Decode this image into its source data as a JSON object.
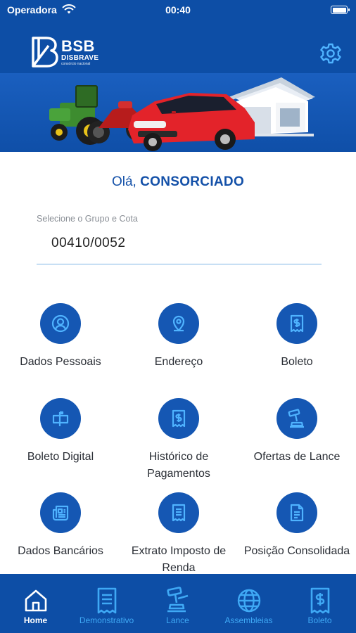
{
  "status_bar": {
    "carrier": "Operadora",
    "time": "00:40",
    "battery_level": 1.0
  },
  "header": {
    "logo_text": "BSB",
    "logo_subtext": "DISBRAVE",
    "logo_tagline": "consórcio nacional",
    "settings_icon": "gear-icon"
  },
  "greeting": {
    "prefix": "Olá,",
    "name": "CONSORCIADO"
  },
  "group_select": {
    "label": "Selecione o Grupo e Cota",
    "value": "00410/0052"
  },
  "menu": {
    "items": [
      {
        "id": "dados-pessoais",
        "label": "Dados Pessoais",
        "icon": "user-icon"
      },
      {
        "id": "endereco",
        "label": "Endereço",
        "icon": "location-pin-icon"
      },
      {
        "id": "boleto",
        "label": "Boleto",
        "icon": "receipt-dollar-icon"
      },
      {
        "id": "boleto-digital",
        "label": "Boleto Digital",
        "icon": "mailbox-icon"
      },
      {
        "id": "historico-pagamentos",
        "label": "Histórico de Pagamentos",
        "icon": "receipt-dollar-icon"
      },
      {
        "id": "ofertas-lance",
        "label": "Ofertas de Lance",
        "icon": "gavel-icon"
      },
      {
        "id": "dados-bancarios",
        "label": "Dados Bancários",
        "icon": "newspaper-icon"
      },
      {
        "id": "extrato-imposto-renda",
        "label": "Extrato Imposto de Renda",
        "icon": "document-icon"
      },
      {
        "id": "posicao-consolidada",
        "label": "Posição Consolidada",
        "icon": "file-text-icon"
      }
    ]
  },
  "tab_bar": {
    "tabs": [
      {
        "id": "home",
        "label": "Home",
        "icon": "home-icon",
        "active": true
      },
      {
        "id": "demonstrativo",
        "label": "Demonstrativo",
        "icon": "document-icon",
        "active": false
      },
      {
        "id": "lance",
        "label": "Lance",
        "icon": "gavel-icon",
        "active": false
      },
      {
        "id": "assembleias",
        "label": "Assembleias",
        "icon": "globe-icon",
        "active": false
      },
      {
        "id": "boleto",
        "label": "Boleto",
        "icon": "receipt-dollar-icon",
        "active": false
      }
    ]
  },
  "colors": {
    "primary": "#0d4ea6",
    "icon_circle": "#1557b3",
    "tab_inactive": "#3fa9f5",
    "tab_active": "#ffffff",
    "greeting": "#1350a8"
  }
}
